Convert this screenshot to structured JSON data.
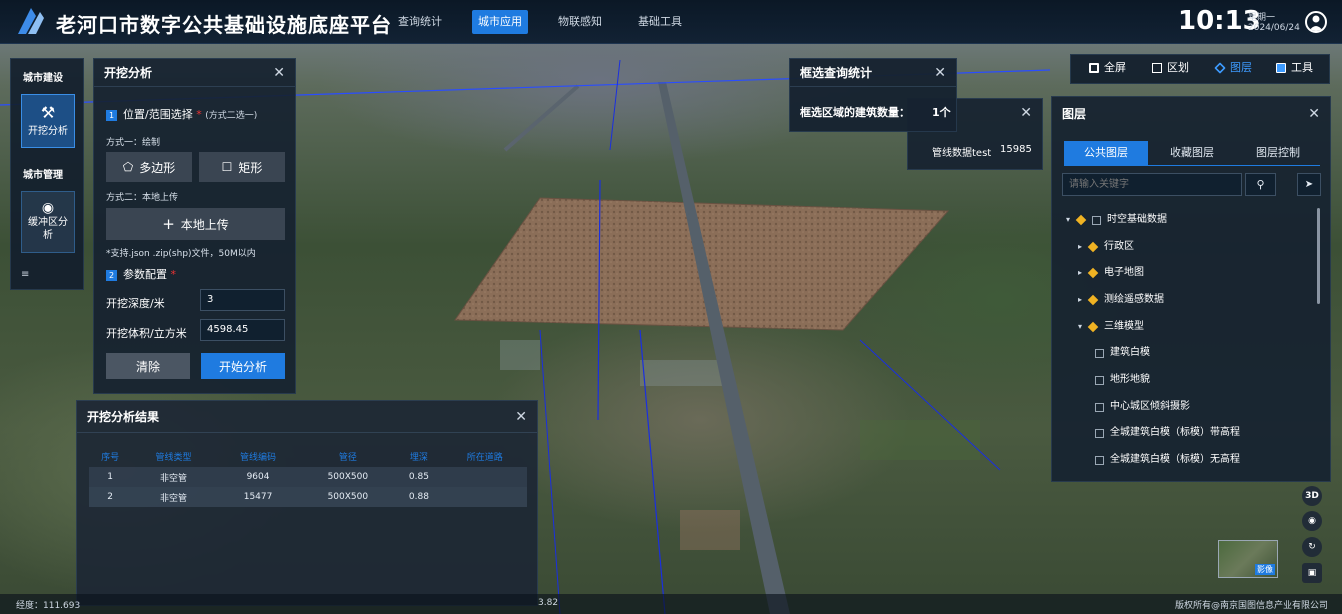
{
  "header": {
    "title": "老河口市数字公共基础设施底座平台",
    "nav": [
      "查询统计",
      "城市应用",
      "物联感知",
      "基础工具"
    ],
    "active_nav": "城市应用",
    "time": "10:13",
    "weekday": "星期一",
    "date": "2024/06/24"
  },
  "sidebar": {
    "section1": "城市建设",
    "item1": "开挖分析",
    "section2": "城市管理",
    "item2": "缓冲区分析"
  },
  "excavate": {
    "title": "开挖分析",
    "step1_num": "1",
    "step1": "位置/范围选择",
    "step1_req": "*",
    "step1_hint": "(方式二选一)",
    "mode1": "方式一：绘制",
    "polygon": "多边形",
    "rect": "矩形",
    "mode2": "方式二：本地上传",
    "upload": "本地上传",
    "upload_hint": "*支持.json .zip(shp)文件，50M以内",
    "step2_num": "2",
    "step2": "参数配置",
    "step2_req": "*",
    "depth_label": "开挖深度/米",
    "depth_value": "3",
    "volume_label": "开挖体积/立方米",
    "volume_value": "4598.45",
    "clear": "清除",
    "start": "开始分析"
  },
  "result": {
    "title": "开挖分析结果",
    "columns": [
      "序号",
      "管线类型",
      "管线编码",
      "管径",
      "埋深",
      "所在道路"
    ],
    "rows": [
      [
        "1",
        "非空管",
        "9604",
        "500X500",
        "0.85",
        ""
      ],
      [
        "2",
        "非空管",
        "15477",
        "500X500",
        "0.88",
        ""
      ]
    ]
  },
  "stats": {
    "title": "框选查询统计",
    "label": "框选区域的建筑数量：",
    "value": "1个"
  },
  "pipeline": {
    "name": "管线数据test",
    "value": "15985"
  },
  "toolbar": {
    "full": "全屏",
    "district": "区划",
    "layer": "图层",
    "tool": "工具"
  },
  "layers": {
    "title": "图层",
    "tabs": [
      "公共图层",
      "收藏图层",
      "图层控制"
    ],
    "search_placeholder": "请输入关键字",
    "items": [
      {
        "label": "时空基础数据",
        "level": 0,
        "expanded": true,
        "cube": true,
        "checkbox": true
      },
      {
        "label": "行政区",
        "level": 1,
        "expanded": false,
        "cube": true,
        "checkbox": false
      },
      {
        "label": "电子地图",
        "level": 1,
        "expanded": false,
        "cube": true,
        "checkbox": false
      },
      {
        "label": "测绘遥感数据",
        "level": 1,
        "expanded": false,
        "cube": true,
        "checkbox": false
      },
      {
        "label": "三维模型",
        "level": 1,
        "expanded": true,
        "cube": true,
        "checkbox": false
      },
      {
        "label": "建筑白模",
        "level": 2,
        "checkbox": true
      },
      {
        "label": "地形地貌",
        "level": 2,
        "checkbox": true
      },
      {
        "label": "中心城区倾斜摄影",
        "level": 2,
        "checkbox": true
      },
      {
        "label": "全城建筑白模（标模）带高程",
        "level": 2,
        "checkbox": true
      },
      {
        "label": "全城建筑白模（标模）无高程",
        "level": 2,
        "checkbox": true
      }
    ]
  },
  "map": {
    "view3d": "3D",
    "thumb_label": "影像",
    "coord": "经度：111.693",
    "coord2": "3.82",
    "copyright": "版权所有@南京国图信息产业有限公司"
  }
}
